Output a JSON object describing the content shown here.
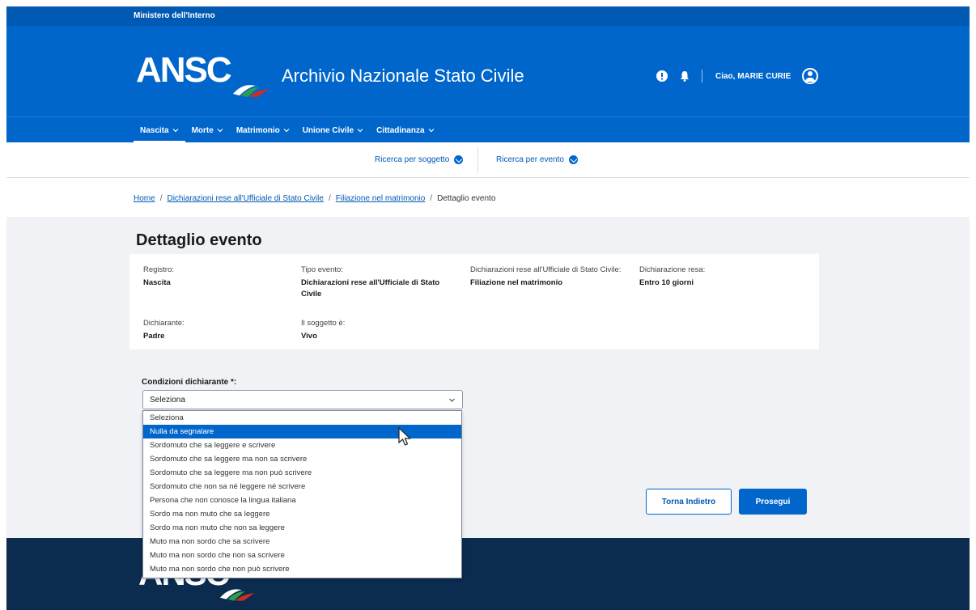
{
  "topbar": {
    "org": "Ministero dell'Interno"
  },
  "header": {
    "logo": "ANSC",
    "app_title": "Archivio Nazionale Stato Civile",
    "icons": [
      "info-icon",
      "bell-icon",
      "user-avatar-icon"
    ],
    "greeting": "Ciao, MARIE CURIE"
  },
  "nav": {
    "items": [
      {
        "label": "Nascita",
        "active": true
      },
      {
        "label": "Morte"
      },
      {
        "label": "Matrimonio"
      },
      {
        "label": "Unione Civile"
      },
      {
        "label": "Cittadinanza"
      }
    ]
  },
  "subnav": {
    "search_subject": "Ricerca per soggetto",
    "search_event": "Ricerca per evento"
  },
  "breadcrumb": {
    "home": "Home",
    "level1": "Dichiarazioni rese all'Ufficiale di Stato Civile",
    "level2": "Filiazione nel matrimonio",
    "current": "Dettaglio evento"
  },
  "main": {
    "title": "Dettaglio evento",
    "fields": {
      "registro": {
        "label": "Registro:",
        "value": "Nascita"
      },
      "tipo_evento": {
        "label": "Tipo evento:",
        "value": "Dichiarazioni rese all'Ufficiale di Stato Civile"
      },
      "dichiarazioni": {
        "label": "Dichiarazioni rese all'Ufficiale di Stato Civile:",
        "value": "Filiazione nel matrimonio"
      },
      "dichiarazione_resa": {
        "label": "Dichiarazione resa:",
        "value": "Entro 10 giorni"
      },
      "dichiarante": {
        "label": "Dichiarante:",
        "value": "Padre"
      },
      "soggetto": {
        "label": "Il soggetto è:",
        "value": "Vivo"
      }
    },
    "condition_label": "Condizioni dichiarante *:",
    "select_value": "Seleziona",
    "options": [
      "Seleziona",
      "Nulla da segnalare",
      "Sordomuto che sa leggere e scrivere",
      "Sordomuto che sa leggere ma non sa scrivere",
      "Sordomuto che sa leggere ma non può scrivere",
      "Sordomuto che non sa né leggere né scrivere",
      "Persona che non conosce la lingua italiana",
      "Sordo ma non muto che sa leggere",
      "Sordo ma non muto che non sa leggere",
      "Muto ma non sordo che sa scrivere",
      "Muto ma non sordo che non sa scrivere",
      "Muto ma non sordo che non può scrivere"
    ],
    "highlighted_option": "Nulla da segnalare",
    "back_button": "Torna Indietro",
    "next_button": "Prosegui"
  },
  "footer": {
    "logo": "ANSC"
  },
  "colors": {
    "primary": "#0066cc",
    "topbar": "#0059b3",
    "footer": "#0b2b4f",
    "content_bg": "#f0f2f5"
  }
}
